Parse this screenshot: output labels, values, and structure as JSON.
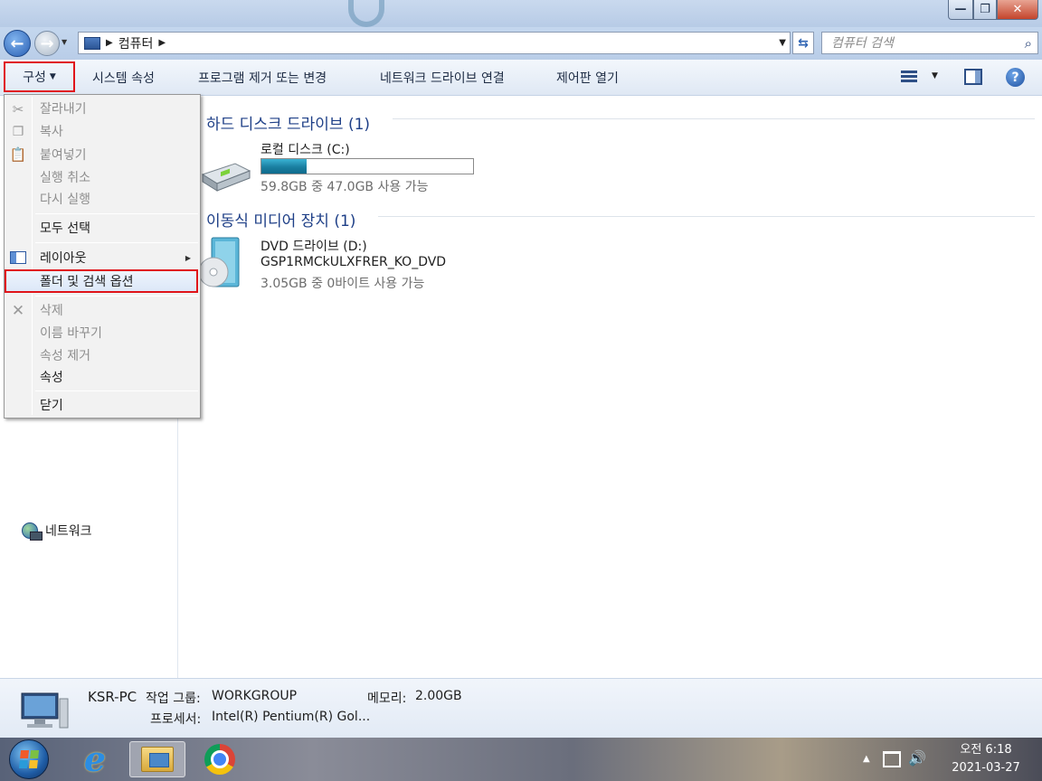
{
  "window": {
    "breadcrumb": "컴퓨터",
    "search_placeholder": "컴퓨터 검색",
    "controls": {
      "minimize": "—",
      "maximize": "❐",
      "close": "✕"
    }
  },
  "toolbar": {
    "organize_label": "구성",
    "system_properties": "시스템 속성",
    "uninstall_program": "프로그램 제거 또는 변경",
    "map_network_drive": "네트워크 드라이브 연결",
    "open_control_panel": "제어판 열기"
  },
  "organize_menu": {
    "items": [
      {
        "label": "잘라내기",
        "enabled": false,
        "icon": "scissors-icon"
      },
      {
        "label": "복사",
        "enabled": false,
        "icon": "copy-icon"
      },
      {
        "label": "붙여넣기",
        "enabled": false,
        "icon": "paste-icon"
      },
      {
        "label": "실행 취소",
        "enabled": false
      },
      {
        "label": "다시 실행",
        "enabled": false
      },
      {
        "label": "모두 선택",
        "enabled": true
      },
      {
        "label": "레이아웃",
        "enabled": true,
        "icon": "layout-icon",
        "submenu": true
      },
      {
        "label": "폴더 및 검색 옵션",
        "enabled": true,
        "highlighted": true
      },
      {
        "label": "삭제",
        "enabled": false,
        "icon": "delete-icon"
      },
      {
        "label": "이름 바꾸기",
        "enabled": false
      },
      {
        "label": "속성 제거",
        "enabled": false
      },
      {
        "label": "속성",
        "enabled": true
      },
      {
        "label": "닫기",
        "enabled": true
      }
    ]
  },
  "navigation": {
    "network_label": "네트워크"
  },
  "groups": {
    "hard_disks": {
      "title": "하드 디스크 드라이브 (1)",
      "drive": {
        "name": "로컬 디스크 (C:)",
        "space": "59.8GB 중 47.0GB 사용 가능",
        "used_fraction": 0.214
      }
    },
    "removable": {
      "title": "이동식 미디어 장치 (1)",
      "drive": {
        "name": "DVD 드라이브 (D:)",
        "label": "GSP1RMCkULXFRER_KO_DVD",
        "space": "3.05GB 중 0바이트 사용 가능"
      }
    }
  },
  "details": {
    "computer_name": "KSR-PC",
    "workgroup_label": "작업 그룹:",
    "workgroup": "WORKGROUP",
    "memory_label": "메모리:",
    "memory": "2.00GB",
    "processor_label": "프로세서:",
    "processor": "Intel(R) Pentium(R) Gol..."
  },
  "taskbar": {
    "time": "오전 6:18",
    "date": "2021-03-27"
  },
  "colors": {
    "highlight_box": "#e0141a",
    "group_title": "#1e3f87",
    "drive_bar": "#1a7fa0"
  }
}
